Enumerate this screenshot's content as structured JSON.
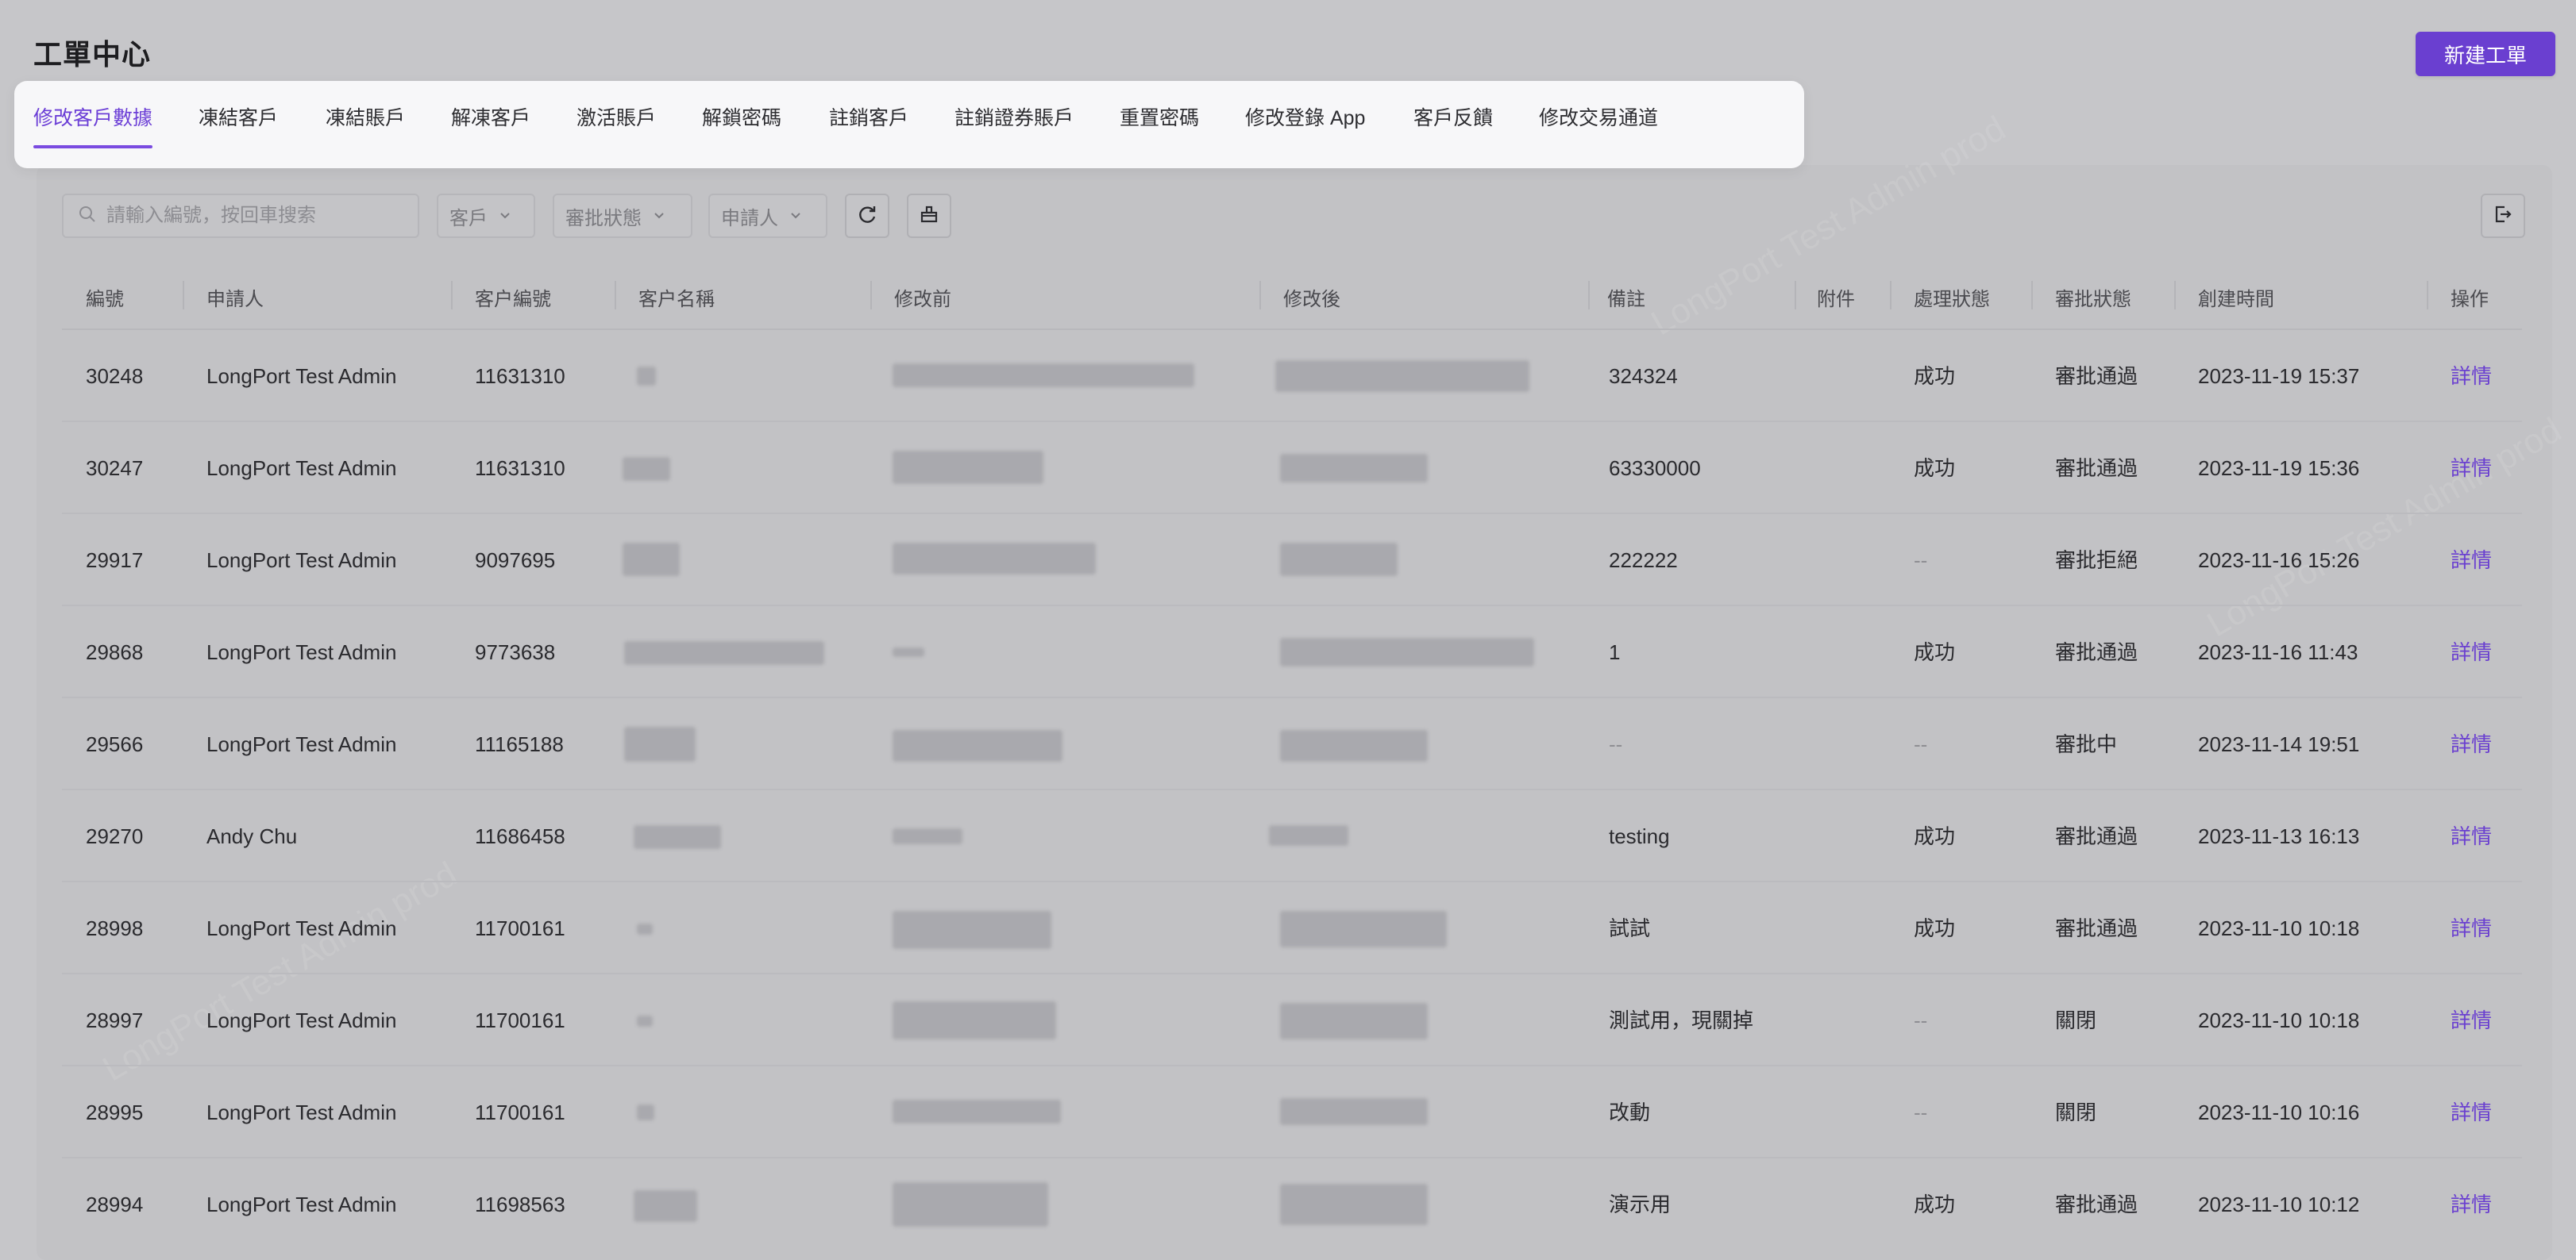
{
  "page": {
    "title": "工單中心",
    "new_button": "新建工單"
  },
  "tabs": [
    {
      "label": "修改客戶數據",
      "active": true
    },
    {
      "label": "凍結客戶"
    },
    {
      "label": "凍結賬戶"
    },
    {
      "label": "解凍客戶"
    },
    {
      "label": "激活賬戶"
    },
    {
      "label": "解鎖密碼"
    },
    {
      "label": "註銷客戶"
    },
    {
      "label": "註銷證券賬戶"
    },
    {
      "label": "重置密碼"
    },
    {
      "label": "修改登錄 App"
    },
    {
      "label": "客戶反饋"
    },
    {
      "label": "修改交易通道"
    }
  ],
  "toolbar": {
    "search_placeholder": "請輸入編號，按回車搜索",
    "filter_customer": "客戶",
    "filter_approval": "審批狀態",
    "filter_applicant": "申請人"
  },
  "watermark_text": "LongPort Test Admin prod",
  "table": {
    "columns": [
      "編號",
      "申請人",
      "客户編號",
      "客户名稱",
      "修改前",
      "修改後",
      "備註",
      "附件",
      "處理狀態",
      "審批狀態",
      "創建時間",
      "操作"
    ],
    "rows": [
      {
        "id": "30248",
        "applicant": "LongPort Test Admin",
        "cust_no": "11631310",
        "note": "324324",
        "process": "成功",
        "approval": "審批通過",
        "created": "2023-11-19 15:37",
        "action": "詳情"
      },
      {
        "id": "30247",
        "applicant": "LongPort Test Admin",
        "cust_no": "11631310",
        "note": "63330000",
        "process": "成功",
        "approval": "審批通過",
        "created": "2023-11-19 15:36",
        "action": "詳情"
      },
      {
        "id": "29917",
        "applicant": "LongPort Test Admin",
        "cust_no": "9097695",
        "note": "222222",
        "process": "--",
        "approval": "審批拒絕",
        "created": "2023-11-16 15:26",
        "action": "詳情"
      },
      {
        "id": "29868",
        "applicant": "LongPort Test Admin",
        "cust_no": "9773638",
        "note": "1",
        "process": "成功",
        "approval": "審批通過",
        "created": "2023-11-16 11:43",
        "action": "詳情"
      },
      {
        "id": "29566",
        "applicant": "LongPort Test Admin",
        "cust_no": "11165188",
        "note": "--",
        "process": "--",
        "approval": "審批中",
        "created": "2023-11-14 19:51",
        "action": "詳情"
      },
      {
        "id": "29270",
        "applicant": "Andy Chu",
        "cust_no": "11686458",
        "note": "testing",
        "process": "成功",
        "approval": "審批通過",
        "created": "2023-11-13 16:13",
        "action": "詳情"
      },
      {
        "id": "28998",
        "applicant": "LongPort Test Admin",
        "cust_no": "11700161",
        "note": "試試",
        "process": "成功",
        "approval": "審批通過",
        "created": "2023-11-10 10:18",
        "action": "詳情"
      },
      {
        "id": "28997",
        "applicant": "LongPort Test Admin",
        "cust_no": "11700161",
        "note": "測試用，現關掉",
        "process": "--",
        "approval": "關閉",
        "created": "2023-11-10 10:18",
        "action": "詳情"
      },
      {
        "id": "28995",
        "applicant": "LongPort Test Admin",
        "cust_no": "11700161",
        "note": "改動",
        "process": "--",
        "approval": "關閉",
        "created": "2023-11-10 10:16",
        "action": "詳情"
      },
      {
        "id": "28994",
        "applicant": "LongPort Test Admin",
        "cust_no": "11698563",
        "note": "演示用",
        "process": "成功",
        "approval": "審批通過",
        "created": "2023-11-10 10:12",
        "action": "詳情"
      }
    ]
  },
  "colors": {
    "accent": "#6a3fd0",
    "overlay": "#c6c6c9",
    "popover_bg": "#f7f7f9"
  }
}
